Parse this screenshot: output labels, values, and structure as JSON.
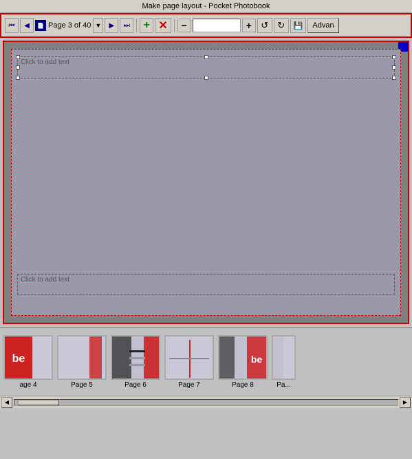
{
  "title": "Make page layout - Pocket Photobook",
  "toolbar": {
    "first_label": "⏮",
    "prev_label": "◀",
    "next_label": "▶",
    "last_label": "⏭",
    "page_text": "Page 3 of 40",
    "add_label": "+",
    "delete_label": "✕",
    "zoom_minus_label": "−",
    "zoom_value": "",
    "zoom_plus_label": "+",
    "refresh1_label": "↺",
    "refresh2_label": "↻",
    "save_label": "💾",
    "advanced_label": "Advan"
  },
  "canvas": {
    "text_placeholder_top": "Click to add text",
    "text_placeholder_bottom": "Click to add text"
  },
  "thumbnails": [
    {
      "label": "age 4",
      "type": "page4"
    },
    {
      "label": "Page 5",
      "type": "page5"
    },
    {
      "label": "Page 6",
      "type": "page6"
    },
    {
      "label": "Page 7",
      "type": "page7"
    },
    {
      "label": "Page 8",
      "type": "page8"
    },
    {
      "label": "Pa...",
      "type": "pagex"
    }
  ],
  "colors": {
    "accent": "#cc0000",
    "nav": "#000080"
  }
}
